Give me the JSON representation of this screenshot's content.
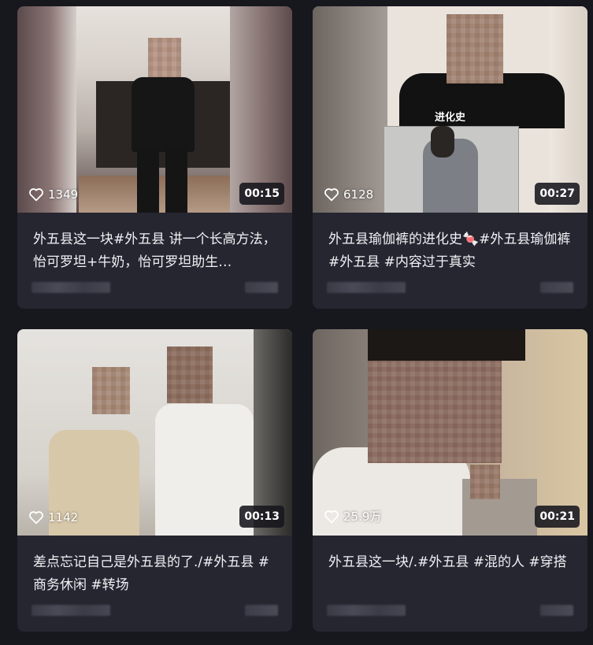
{
  "cards": [
    {
      "likes": "1349",
      "duration": "00:15",
      "title": "外五县这一块#外五县 讲一个长高方法，怡可罗坦+牛奶，怡可罗坦助生…",
      "overlay_text": ""
    },
    {
      "likes": "6128",
      "duration": "00:27",
      "title": "外五县瑜伽裤的进化史🍬#外五县瑜伽裤 #外五县 #内容过于真实",
      "overlay_text": "进化史"
    },
    {
      "likes": "1142",
      "duration": "00:13",
      "title": "差点忘记自己是外五县的了./#外五县 #商务休闲 #转场",
      "overlay_text": ""
    },
    {
      "likes": "25.9万",
      "duration": "00:21",
      "title": "外五县这一块/.#外五县 #混的人 #穿搭",
      "overlay_text": ""
    }
  ],
  "icons": {
    "like": "heart-outline-icon"
  },
  "colors": {
    "background": "#17171e",
    "card": "#262631",
    "badge": "#16161c"
  }
}
